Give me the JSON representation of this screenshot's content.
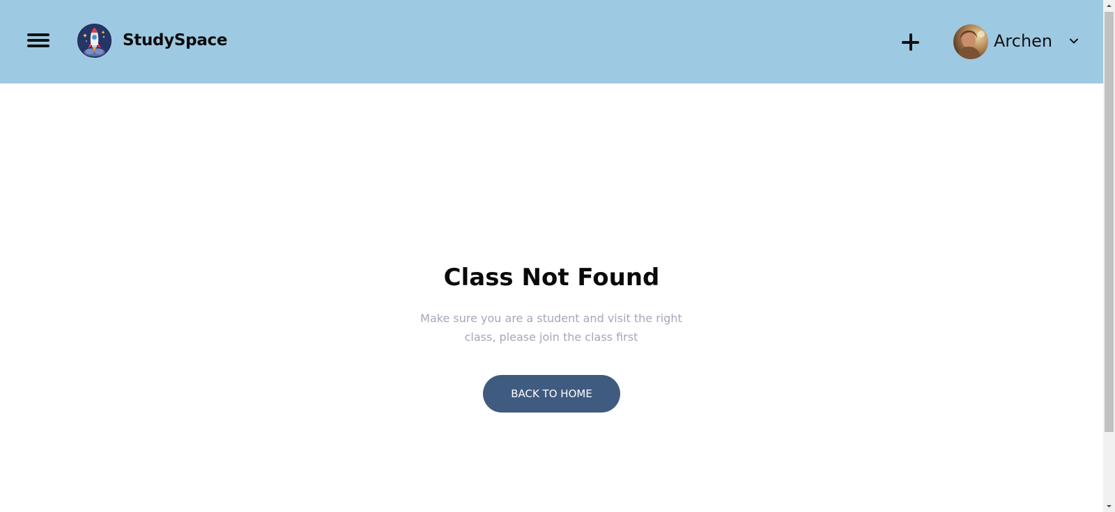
{
  "header": {
    "brand": "StudySpace",
    "background_color": "#9ec9e2",
    "menu_icon": "hamburger-menu-icon",
    "logo_icon": "rocket-logo-icon",
    "add_icon": "plus-icon",
    "user": {
      "name": "Archen",
      "avatar_icon": "user-avatar",
      "dropdown_icon": "chevron-down-icon"
    }
  },
  "main": {
    "title": "Class Not Found",
    "message_line1": "Make sure you are a student and visit the right",
    "message_line2": "class, please join the class first",
    "button_label": "BACK TO HOME",
    "button_color": "#405b80"
  },
  "scrollbar": {
    "up_icon": "arrow-up-icon",
    "down_icon": "arrow-down-icon"
  }
}
